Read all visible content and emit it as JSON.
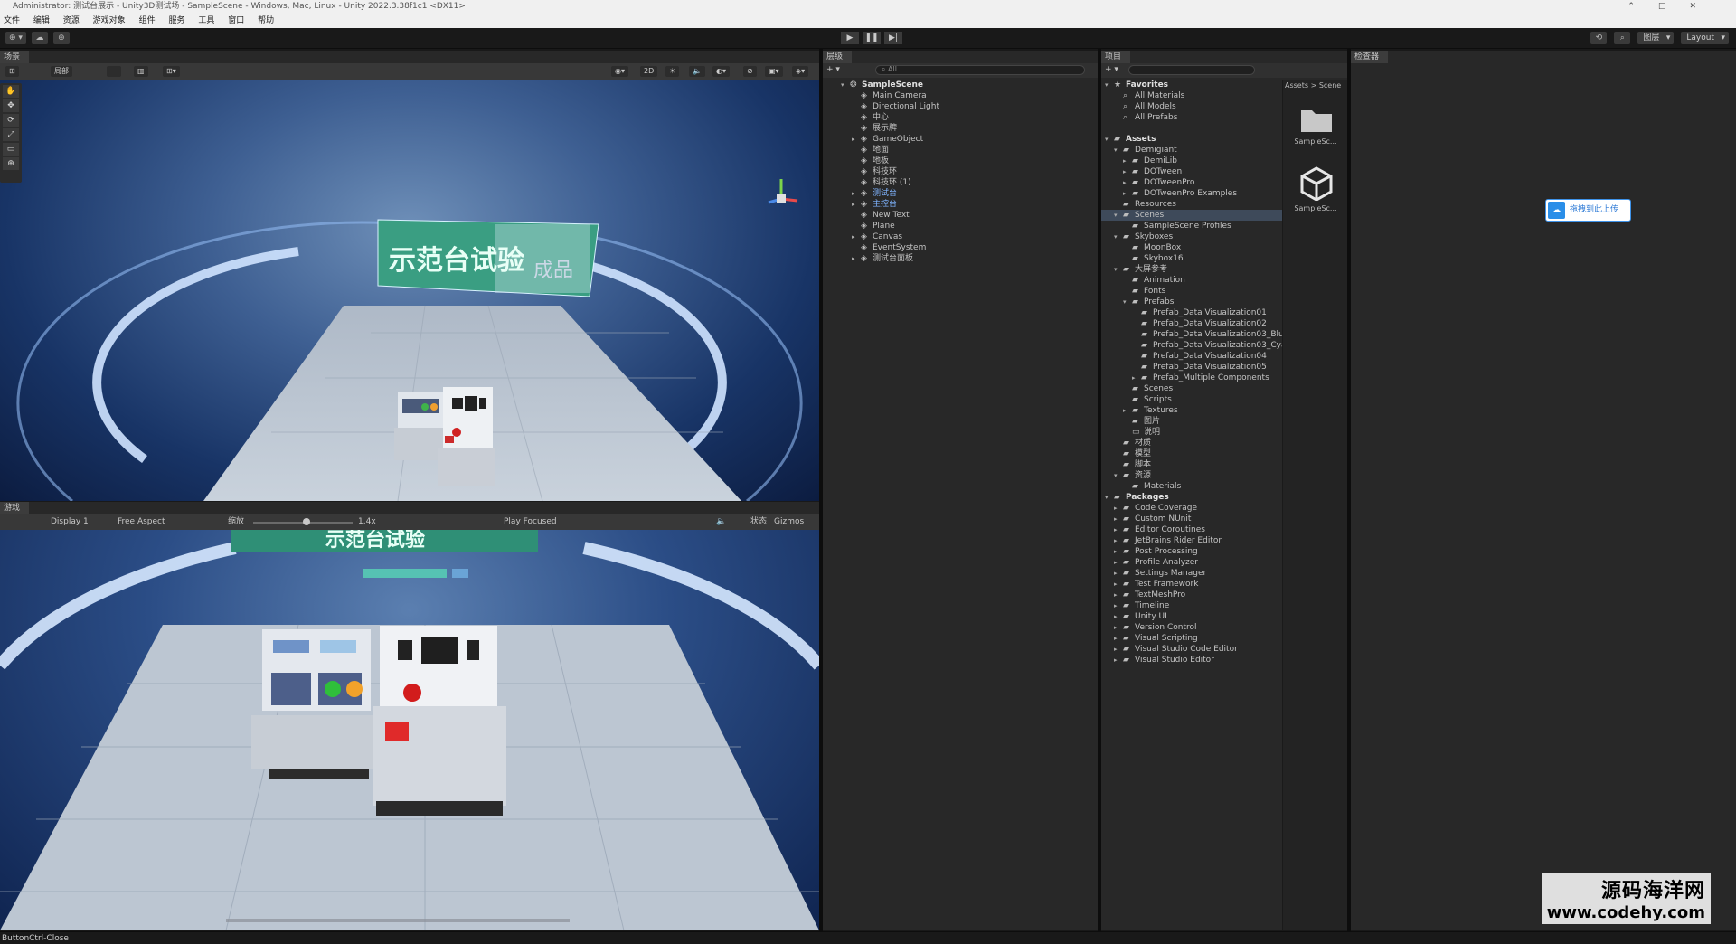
{
  "window": {
    "title": "Administrator: 测试台展示 - Unity3D测试场 - SampleScene - Windows, Mac, Linux - Unity 2022.3.38f1c1 <DX11>",
    "controls": [
      "⌃",
      "□",
      "✕"
    ]
  },
  "menu": [
    "文件",
    "编辑",
    "资源",
    "游戏对象",
    "组件",
    "服务",
    "工具",
    "窗口",
    "帮助"
  ],
  "toolbar": {
    "account": "⊕ ▾",
    "cloud": "☁",
    "collab": "⊕",
    "play": "▶",
    "pause": "❚❚",
    "step": "▶|",
    "history": "⟲",
    "search": "⌕",
    "layers": "图层",
    "layout": "Layout"
  },
  "scene": {
    "tab": "场景",
    "tools": [
      "⊞",
      "局部",
      "⋯",
      "▥",
      "⊞▾"
    ],
    "right_tools": [
      "◉▾",
      "2D",
      "☀",
      "🔈",
      "◐▾",
      "⊘",
      "▣▾",
      "◈▾"
    ],
    "gizmo_tools": [
      "✋",
      "✥",
      "⟳",
      "⤢",
      "▭",
      "⊕"
    ],
    "screen_text": "示范台试验",
    "screen_side": "成品"
  },
  "game": {
    "tab": "游戏",
    "display": "Display 1",
    "aspect": "Free Aspect",
    "scale_label": "缩放",
    "scale_value": "1.4x",
    "play_mode": "Play Focused",
    "mute": "🔈",
    "stats": "状态",
    "gizmos": "Gizmos"
  },
  "hierarchy": {
    "tab": "层级",
    "add": "+ ▾",
    "search_placeholder": "⌕ All",
    "items": [
      {
        "label": "SampleScene",
        "depth": 0,
        "arrow": "▾",
        "icon": "❂",
        "style": "bold"
      },
      {
        "label": "Main Camera",
        "depth": 1,
        "arrow": "",
        "icon": "◈",
        "style": ""
      },
      {
        "label": "Directional Light",
        "depth": 1,
        "arrow": "",
        "icon": "◈",
        "style": ""
      },
      {
        "label": "中心",
        "depth": 1,
        "arrow": "",
        "icon": "◈",
        "style": ""
      },
      {
        "label": "展示牌",
        "depth": 1,
        "arrow": "",
        "icon": "◈",
        "style": ""
      },
      {
        "label": "GameObject",
        "depth": 1,
        "arrow": "▸",
        "icon": "◈",
        "style": ""
      },
      {
        "label": "地面",
        "depth": 1,
        "arrow": "",
        "icon": "◈",
        "style": ""
      },
      {
        "label": "地板",
        "depth": 1,
        "arrow": "",
        "icon": "◈",
        "style": ""
      },
      {
        "label": "科技环",
        "depth": 1,
        "arrow": "",
        "icon": "◈",
        "style": ""
      },
      {
        "label": "科技环 (1)",
        "depth": 1,
        "arrow": "",
        "icon": "◈",
        "style": ""
      },
      {
        "label": "测试台",
        "depth": 1,
        "arrow": "▸",
        "icon": "◈",
        "style": "blue"
      },
      {
        "label": "主控台",
        "depth": 1,
        "arrow": "▸",
        "icon": "◈",
        "style": "blue"
      },
      {
        "label": "New Text",
        "depth": 1,
        "arrow": "",
        "icon": "◈",
        "style": ""
      },
      {
        "label": "Plane",
        "depth": 1,
        "arrow": "",
        "icon": "◈",
        "style": ""
      },
      {
        "label": "Canvas",
        "depth": 1,
        "arrow": "▸",
        "icon": "◈",
        "style": ""
      },
      {
        "label": "EventSystem",
        "depth": 1,
        "arrow": "",
        "icon": "◈",
        "style": ""
      },
      {
        "label": "测试台面板",
        "depth": 1,
        "arrow": "▸",
        "icon": "◈",
        "style": ""
      }
    ]
  },
  "project": {
    "tab": "项目",
    "add": "+ ▾",
    "breadcrumb": "Assets > Scene",
    "thumbs": [
      {
        "label": "SampleSc...",
        "kind": "folder"
      },
      {
        "label": "SampleSc...",
        "kind": "unity"
      }
    ],
    "items": [
      {
        "label": "Favorites",
        "depth": 0,
        "arrow": "▾",
        "icon": "★",
        "style": "bold"
      },
      {
        "label": "All Materials",
        "depth": 1,
        "arrow": "",
        "icon": "⌕",
        "style": ""
      },
      {
        "label": "All Models",
        "depth": 1,
        "arrow": "",
        "icon": "⌕",
        "style": ""
      },
      {
        "label": "All Prefabs",
        "depth": 1,
        "arrow": "",
        "icon": "⌕",
        "style": ""
      },
      {
        "label": "",
        "depth": 0,
        "arrow": "",
        "icon": "",
        "style": ""
      },
      {
        "label": "Assets",
        "depth": 0,
        "arrow": "▾",
        "icon": "▰",
        "style": "bold"
      },
      {
        "label": "Demigiant",
        "depth": 1,
        "arrow": "▾",
        "icon": "▰",
        "style": ""
      },
      {
        "label": "DemiLib",
        "depth": 2,
        "arrow": "▸",
        "icon": "▰",
        "style": ""
      },
      {
        "label": "DOTween",
        "depth": 2,
        "arrow": "▸",
        "icon": "▰",
        "style": ""
      },
      {
        "label": "DOTweenPro",
        "depth": 2,
        "arrow": "▸",
        "icon": "▰",
        "style": ""
      },
      {
        "label": "DOTweenPro Examples",
        "depth": 2,
        "arrow": "▸",
        "icon": "▰",
        "style": ""
      },
      {
        "label": "Resources",
        "depth": 1,
        "arrow": "",
        "icon": "▰",
        "style": ""
      },
      {
        "label": "Scenes",
        "depth": 1,
        "arrow": "▾",
        "icon": "▰",
        "style": "sel"
      },
      {
        "label": "SampleScene Profiles",
        "depth": 2,
        "arrow": "",
        "icon": "▰",
        "style": ""
      },
      {
        "label": "Skyboxes",
        "depth": 1,
        "arrow": "▾",
        "icon": "▰",
        "style": ""
      },
      {
        "label": "MoonBox",
        "depth": 2,
        "arrow": "",
        "icon": "▰",
        "style": ""
      },
      {
        "label": "Skybox16",
        "depth": 2,
        "arrow": "",
        "icon": "▰",
        "style": ""
      },
      {
        "label": "大屏参考",
        "depth": 1,
        "arrow": "▾",
        "icon": "▰",
        "style": ""
      },
      {
        "label": "Animation",
        "depth": 2,
        "arrow": "",
        "icon": "▰",
        "style": ""
      },
      {
        "label": "Fonts",
        "depth": 2,
        "arrow": "",
        "icon": "▰",
        "style": ""
      },
      {
        "label": "Prefabs",
        "depth": 2,
        "arrow": "▾",
        "icon": "▰",
        "style": ""
      },
      {
        "label": "Prefab_Data Visualization01",
        "depth": 3,
        "arrow": "",
        "icon": "▰",
        "style": ""
      },
      {
        "label": "Prefab_Data Visualization02",
        "depth": 3,
        "arrow": "",
        "icon": "▰",
        "style": ""
      },
      {
        "label": "Prefab_Data Visualization03_Blue",
        "depth": 3,
        "arrow": "",
        "icon": "▰",
        "style": ""
      },
      {
        "label": "Prefab_Data Visualization03_Cyan",
        "depth": 3,
        "arrow": "",
        "icon": "▰",
        "style": ""
      },
      {
        "label": "Prefab_Data Visualization04",
        "depth": 3,
        "arrow": "",
        "icon": "▰",
        "style": ""
      },
      {
        "label": "Prefab_Data Visualization05",
        "depth": 3,
        "arrow": "",
        "icon": "▰",
        "style": ""
      },
      {
        "label": "Prefab_Multiple Components",
        "depth": 3,
        "arrow": "▸",
        "icon": "▰",
        "style": ""
      },
      {
        "label": "Scenes",
        "depth": 2,
        "arrow": "",
        "icon": "▰",
        "style": ""
      },
      {
        "label": "Scripts",
        "depth": 2,
        "arrow": "",
        "icon": "▰",
        "style": ""
      },
      {
        "label": "Textures",
        "depth": 2,
        "arrow": "▸",
        "icon": "▰",
        "style": ""
      },
      {
        "label": "图片",
        "depth": 2,
        "arrow": "",
        "icon": "▰",
        "style": ""
      },
      {
        "label": "说明",
        "depth": 2,
        "arrow": "",
        "icon": "▭",
        "style": ""
      },
      {
        "label": "材质",
        "depth": 1,
        "arrow": "",
        "icon": "▰",
        "style": ""
      },
      {
        "label": "模型",
        "depth": 1,
        "arrow": "",
        "icon": "▰",
        "style": ""
      },
      {
        "label": "脚本",
        "depth": 1,
        "arrow": "",
        "icon": "▰",
        "style": ""
      },
      {
        "label": "资源",
        "depth": 1,
        "arrow": "▾",
        "icon": "▰",
        "style": ""
      },
      {
        "label": "Materials",
        "depth": 2,
        "arrow": "",
        "icon": "▰",
        "style": ""
      },
      {
        "label": "Packages",
        "depth": 0,
        "arrow": "▾",
        "icon": "▰",
        "style": "bold"
      },
      {
        "label": "Code Coverage",
        "depth": 1,
        "arrow": "▸",
        "icon": "▰",
        "style": ""
      },
      {
        "label": "Custom NUnit",
        "depth": 1,
        "arrow": "▸",
        "icon": "▰",
        "style": ""
      },
      {
        "label": "Editor Coroutines",
        "depth": 1,
        "arrow": "▸",
        "icon": "▰",
        "style": ""
      },
      {
        "label": "JetBrains Rider Editor",
        "depth": 1,
        "arrow": "▸",
        "icon": "▰",
        "style": ""
      },
      {
        "label": "Post Processing",
        "depth": 1,
        "arrow": "▸",
        "icon": "▰",
        "style": ""
      },
      {
        "label": "Profile Analyzer",
        "depth": 1,
        "arrow": "▸",
        "icon": "▰",
        "style": ""
      },
      {
        "label": "Settings Manager",
        "depth": 1,
        "arrow": "▸",
        "icon": "▰",
        "style": ""
      },
      {
        "label": "Test Framework",
        "depth": 1,
        "arrow": "▸",
        "icon": "▰",
        "style": ""
      },
      {
        "label": "TextMeshPro",
        "depth": 1,
        "arrow": "▸",
        "icon": "▰",
        "style": ""
      },
      {
        "label": "Timeline",
        "depth": 1,
        "arrow": "▸",
        "icon": "▰",
        "style": ""
      },
      {
        "label": "Unity UI",
        "depth": 1,
        "arrow": "▸",
        "icon": "▰",
        "style": ""
      },
      {
        "label": "Version Control",
        "depth": 1,
        "arrow": "▸",
        "icon": "▰",
        "style": ""
      },
      {
        "label": "Visual Scripting",
        "depth": 1,
        "arrow": "▸",
        "icon": "▰",
        "style": ""
      },
      {
        "label": "Visual Studio Code Editor",
        "depth": 1,
        "arrow": "▸",
        "icon": "▰",
        "style": ""
      },
      {
        "label": "Visual Studio Editor",
        "depth": 1,
        "arrow": "▸",
        "icon": "▰",
        "style": ""
      }
    ]
  },
  "inspector": {
    "tab": "检查器",
    "upload_label": "拖拽到此上传"
  },
  "status": {
    "text": "ButtonCtrl-Close"
  },
  "watermark": {
    "line1": "源码海洋网",
    "line2": "www.codehy.com"
  }
}
